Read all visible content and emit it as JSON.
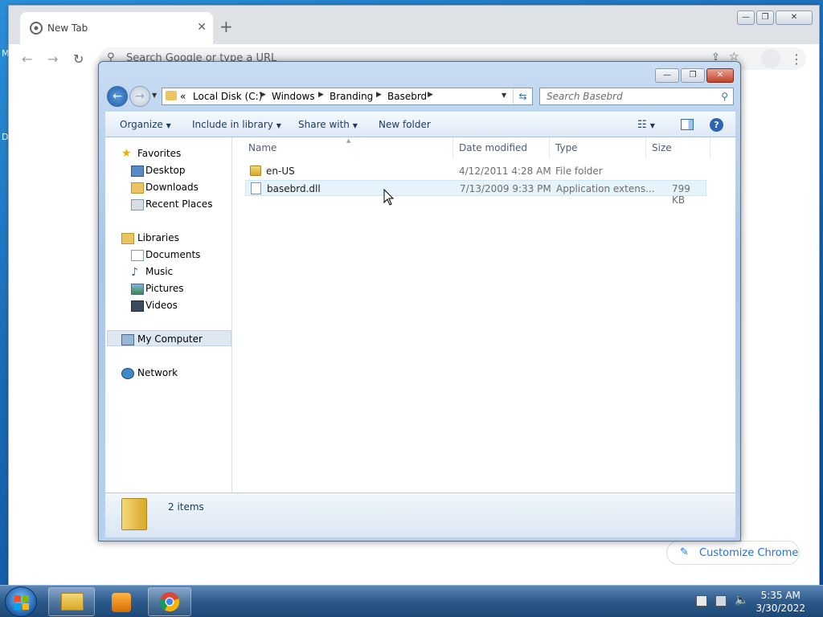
{
  "chrome": {
    "tab_title": "New Tab",
    "tab_close": "✕",
    "new_tab": "+",
    "omnibox_placeholder": "Search Google or type a URL",
    "customize_label": "Customize Chrome",
    "window_buttons": {
      "minimize": "—",
      "maximize": "❐",
      "close": "✕"
    }
  },
  "desktop": {
    "edge_letters": [
      "M",
      "D"
    ]
  },
  "explorer": {
    "breadcrumb_overflow": "«",
    "breadcrumb": [
      "Local Disk (C:)",
      "Windows",
      "Branding",
      "Basebrd"
    ],
    "search_placeholder": "Search Basebrd",
    "commands": {
      "organize": "Organize",
      "include": "Include in library",
      "share": "Share with",
      "new_folder": "New folder"
    },
    "nav": {
      "favorites": "Favorites",
      "desktop": "Desktop",
      "downloads": "Downloads",
      "recent": "Recent Places",
      "libraries": "Libraries",
      "documents": "Documents",
      "music": "Music",
      "pictures": "Pictures",
      "videos": "Videos",
      "computer": "My Computer",
      "network": "Network"
    },
    "columns": {
      "name": "Name",
      "date": "Date modified",
      "type": "Type",
      "size": "Size"
    },
    "files": [
      {
        "name": "en-US",
        "date": "4/12/2011 4:28 AM",
        "type": "File folder",
        "size": ""
      },
      {
        "name": "basebrd.dll",
        "date": "7/13/2009 9:33 PM",
        "type": "Application extens...",
        "size": "799 KB"
      }
    ],
    "status": "2 items"
  },
  "taskbar": {
    "time": "5:35 AM",
    "date": "3/30/2022"
  },
  "colors": {
    "selected_row": "#e5f3fb",
    "chrome_blue": "#1a73e8",
    "selected_nav": "#dde8f3"
  }
}
